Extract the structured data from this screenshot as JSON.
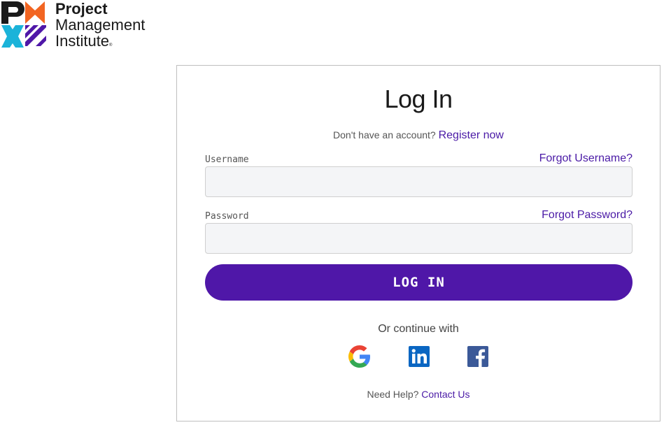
{
  "brand": {
    "line1": "Project",
    "line2": "Management",
    "line3": "Institute",
    "trademark": "®",
    "colors": {
      "orange": "#f26522",
      "cyan": "#1bb3d9",
      "purple": "#4f17a8",
      "dark": "#1a1a1a"
    }
  },
  "login": {
    "title": "Log In",
    "no_account_text": "Don't have an account?",
    "register_link": "Register now",
    "username": {
      "label": "Username",
      "forgot_link": "Forgot Username?",
      "value": "",
      "placeholder": ""
    },
    "password": {
      "label": "Password",
      "forgot_link": "Forgot Password?",
      "value": "",
      "placeholder": ""
    },
    "submit_label": "LOG IN",
    "continue_text": "Or continue with",
    "social": [
      {
        "name": "google",
        "icon": "google-icon"
      },
      {
        "name": "linkedin",
        "icon": "linkedin-icon"
      },
      {
        "name": "facebook",
        "icon": "facebook-icon"
      }
    ],
    "help_text": "Need Help?",
    "contact_link": "Contact Us"
  },
  "theme": {
    "accent": "#4f17a8",
    "link": "#4a1aa6",
    "input_bg": "#f4f5f7",
    "border": "#bfbfbf"
  }
}
